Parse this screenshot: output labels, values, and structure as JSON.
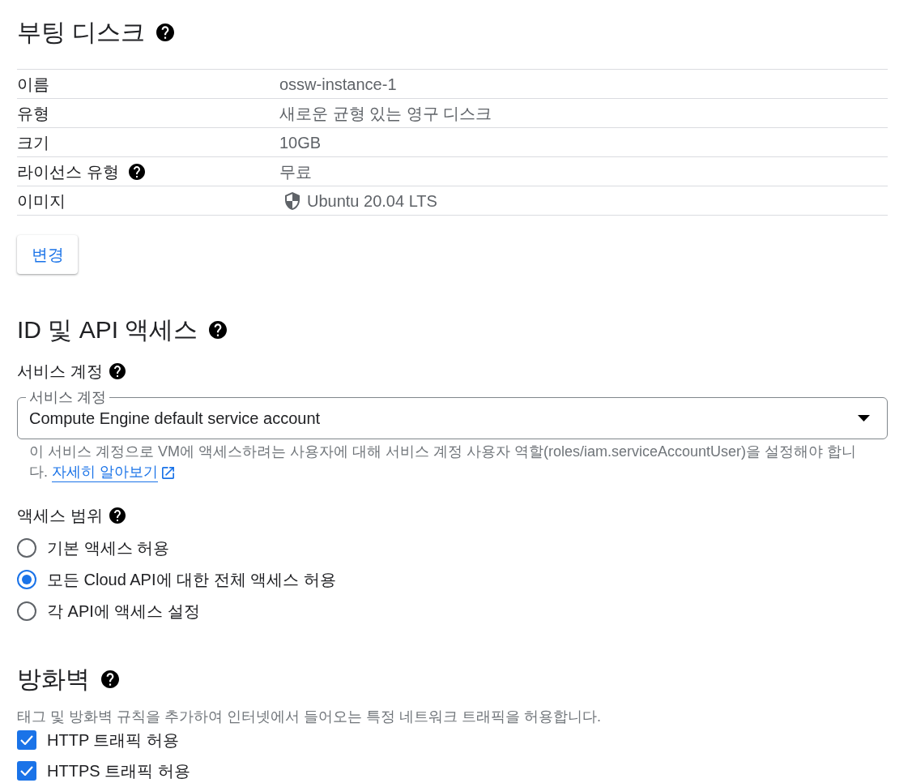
{
  "boot_disk": {
    "title": "부팅 디스크",
    "rows": [
      {
        "kind": "plain",
        "label": "이름",
        "value": "ossw-instance-1"
      },
      {
        "kind": "plain",
        "label": "유형",
        "value": "새로운 균형 있는 영구 디스크"
      },
      {
        "kind": "plain",
        "label": "크기",
        "value": "10GB"
      },
      {
        "kind": "help",
        "label": "라이선스 유형",
        "value": "무료"
      },
      {
        "kind": "os_image",
        "label": "이미지",
        "value": "Ubuntu 20.04 LTS"
      }
    ],
    "change_button": "변경"
  },
  "identity_api": {
    "title": "ID 및 API 액세스",
    "service_account": {
      "label": "서비스 계정",
      "field_label": "서비스 계정",
      "value": "Compute Engine default service account",
      "helper": "이 서비스 계정으로 VM에 액세스하려는 사용자에 대해 서비스 계정 사용자 역할(roles/iam.serviceAccountUser)을 설정해야 합니다.",
      "link": "자세히 알아보기"
    },
    "access_scopes": {
      "label": "액세스 범위",
      "options": [
        {
          "label": "기본 액세스 허용",
          "selected": false
        },
        {
          "label": "모든 Cloud API에 대한 전체 액세스 허용",
          "selected": true
        },
        {
          "label": "각 API에 액세스 설정",
          "selected": false
        }
      ]
    }
  },
  "firewall": {
    "title": "방화벽",
    "description": "태그 및 방화벽 규칙을 추가하여 인터넷에서 들어오는 특정 네트워크 트래픽을 허용합니다.",
    "options": [
      {
        "label": "HTTP 트래픽 허용",
        "checked": true
      },
      {
        "label": "HTTPS 트래픽 허용",
        "checked": true
      }
    ]
  }
}
